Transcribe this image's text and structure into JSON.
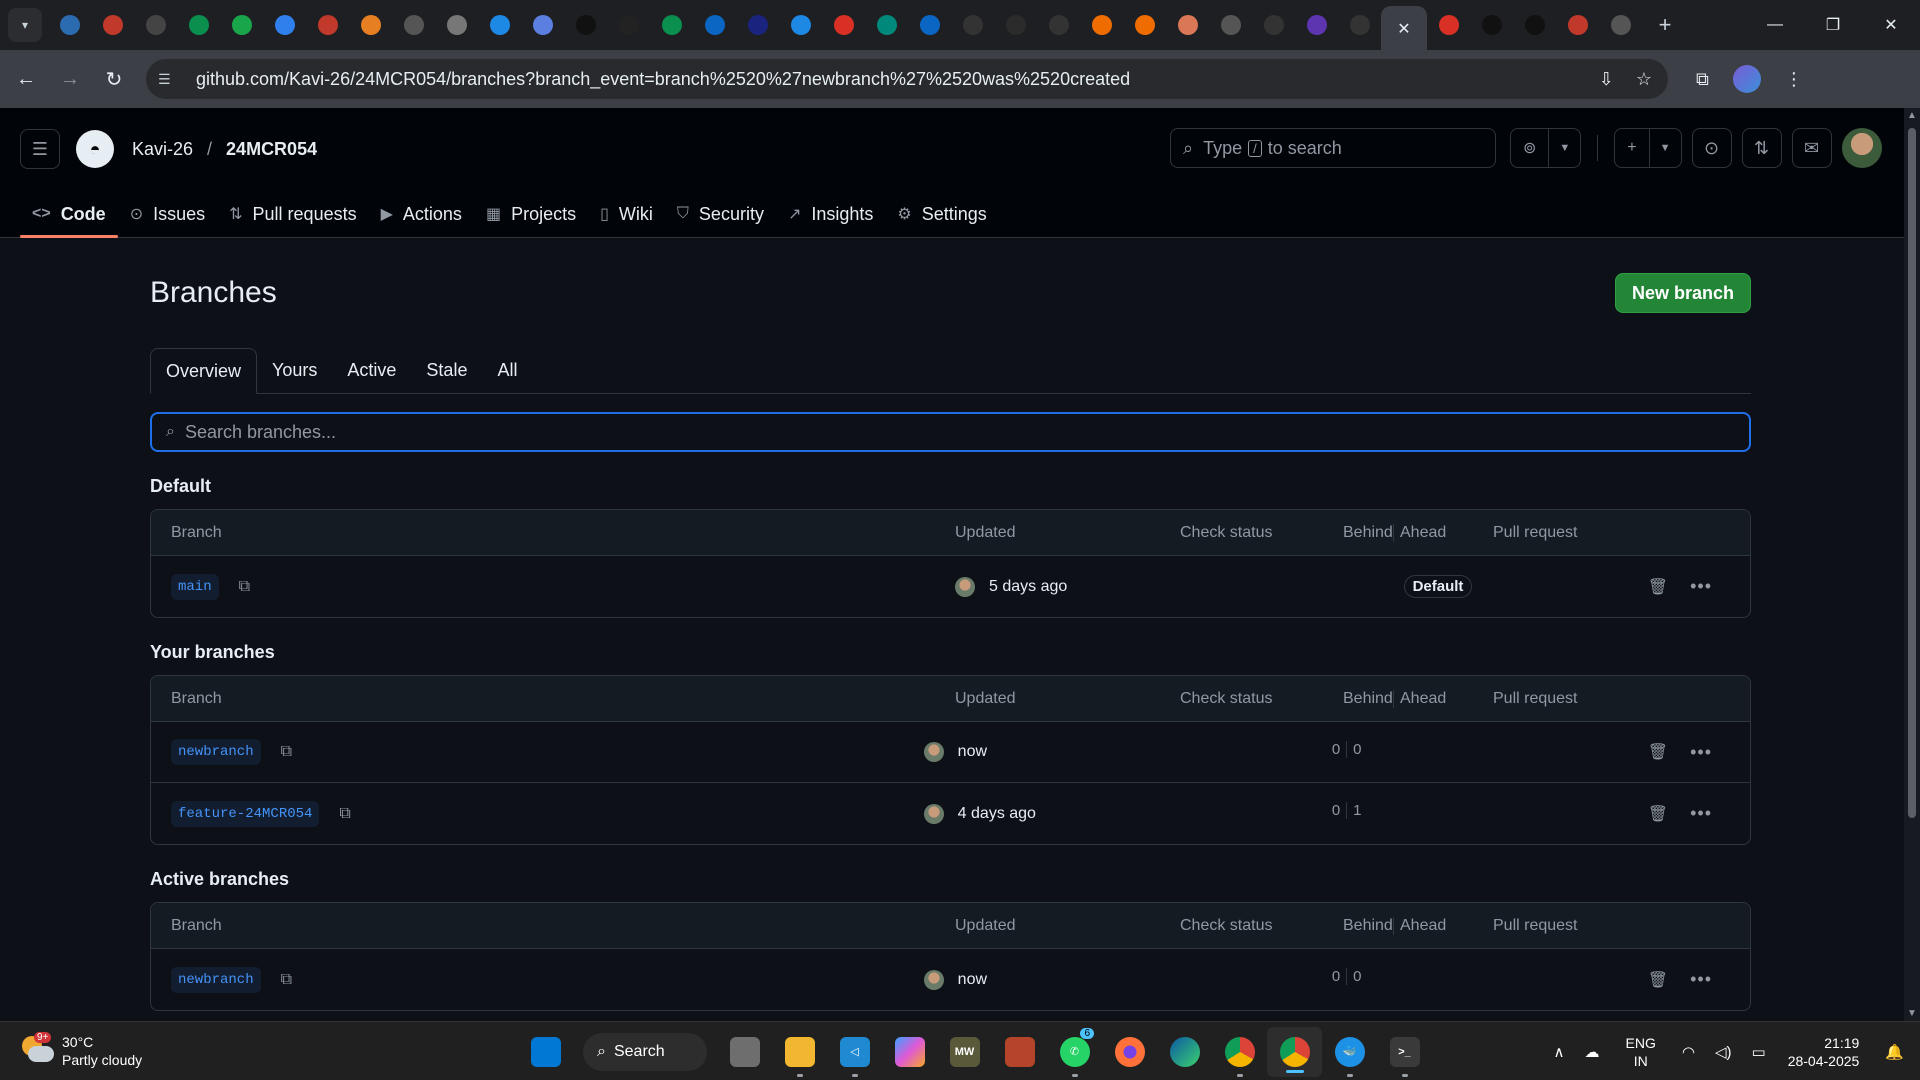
{
  "browser": {
    "url": "github.com/Kavi-26/24MCR054/branches?branch_event=branch%2520%27newbranch%27%2520was%2520created",
    "tab_count_icons": [
      "ds-icon",
      "redhat-icon",
      "dtc-icon",
      "dash-icon",
      "leaf-icon",
      "circle-icon",
      "redhat-icon",
      "flame-icon",
      "a-icon",
      "avatar-icon",
      "x-icon",
      "cube-icon",
      "dev-icon",
      "swirl-icon",
      "ai-icon",
      "linkedin-icon",
      "p-icon",
      "p-blue-icon",
      "gmail-icon",
      "c-icon",
      "linkedin-icon",
      "k-icon",
      "github-dim-icon",
      "copilot-icon",
      "puzzle-icon",
      "puzzle-icon",
      "claude-icon",
      "globe-icon",
      "openai-icon",
      "list-icon",
      "github-icon",
      "close-icon",
      "gmail-icon",
      "dev-icon",
      "dev-icon",
      "layers-icon",
      "chrome-icon"
    ]
  },
  "header": {
    "owner": "Kavi-26",
    "separator": "/",
    "repo": "24MCR054",
    "search_prefix": "Type",
    "search_key": "/",
    "search_suffix": "to search"
  },
  "repo_nav": [
    {
      "label": "Code",
      "icon": "code-icon",
      "glyph": "<>"
    },
    {
      "label": "Issues",
      "icon": "issue-icon",
      "glyph": "⊙"
    },
    {
      "label": "Pull requests",
      "icon": "pull-request-icon",
      "glyph": "⇅"
    },
    {
      "label": "Actions",
      "icon": "play-icon",
      "glyph": "▶"
    },
    {
      "label": "Projects",
      "icon": "table-icon",
      "glyph": "▦"
    },
    {
      "label": "Wiki",
      "icon": "book-icon",
      "glyph": "▯"
    },
    {
      "label": "Security",
      "icon": "shield-icon",
      "glyph": "⛉"
    },
    {
      "label": "Insights",
      "icon": "graph-icon",
      "glyph": "↗"
    },
    {
      "label": "Settings",
      "icon": "gear-icon",
      "glyph": "⚙"
    }
  ],
  "page": {
    "title": "Branches",
    "new_branch_label": "New branch",
    "tabs": [
      "Overview",
      "Yours",
      "Active",
      "Stale",
      "All"
    ],
    "search_placeholder": "Search branches..."
  },
  "columns": {
    "branch": "Branch",
    "updated": "Updated",
    "check": "Check status",
    "behind": "Behind",
    "ahead": "Ahead",
    "pr": "Pull request"
  },
  "sections": {
    "default": {
      "title": "Default",
      "rows": [
        {
          "name": "main",
          "updated": "5 days ago",
          "badge": "Default"
        }
      ]
    },
    "yours": {
      "title": "Your branches",
      "rows": [
        {
          "name": "newbranch",
          "updated": "now",
          "behind": "0",
          "ahead": "0"
        },
        {
          "name": "feature-24MCR054",
          "updated": "4 days ago",
          "behind": "0",
          "ahead": "1"
        }
      ]
    },
    "active": {
      "title": "Active branches",
      "rows": [
        {
          "name": "newbranch",
          "updated": "now",
          "behind": "0",
          "ahead": "0"
        }
      ]
    }
  },
  "taskbar": {
    "temperature": "30°C",
    "weather": "Partly cloudy",
    "weather_badge": "9+",
    "search_label": "Search",
    "whatsapp_badge": "6",
    "lang_top": "ENG",
    "lang_bottom": "IN",
    "time": "21:19",
    "date": "28-04-2025"
  },
  "colors": {
    "accent": "#1f6feb",
    "primary_button": "#238636",
    "nav_underline": "#f78166",
    "branch_text": "#4493f8"
  }
}
